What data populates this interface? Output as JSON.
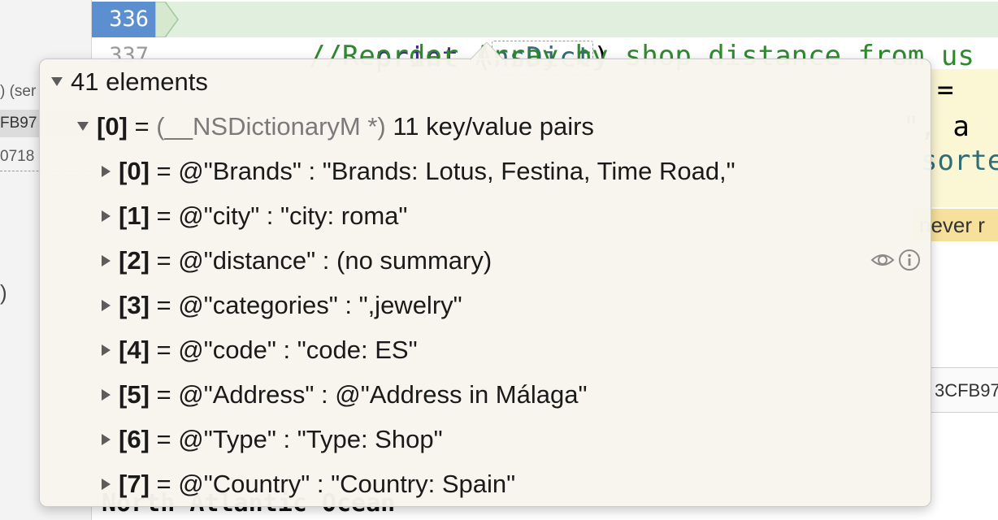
{
  "sidebar": {
    "rows": [
      ") (ser",
      "FB97",
      "0718"
    ]
  },
  "editor": {
    "lines": [
      {
        "number": "336",
        "keyword": "print",
        "open": " (",
        "variable": "nsDict",
        "close": ")"
      },
      {
        "number": "337",
        "comment": "//Reorder Array by shop distance from us"
      }
    ],
    "fragments": {
      "equals": "=",
      "string_quote": "\"",
      "string_tail": ", a",
      "sorted": "sorte",
      "warning": "never r",
      "side_box": "3CFB97",
      "bottom": "North Atlantic Ocean"
    }
  },
  "popover": {
    "root": {
      "label": "41 elements"
    },
    "item0": {
      "index": "[0]",
      "eq": " = ",
      "type": "(__NSDictionaryM *)",
      "summary": " 11 key/value pairs"
    },
    "children": [
      {
        "index": "[0]",
        "text": " = @\"Brands\" : \"Brands: Lotus, Festina, Time Road,\""
      },
      {
        "index": "[1]",
        "text": " = @\"city\" : \"city: roma\""
      },
      {
        "index": "[2]",
        "text": " = @\"distance\" : (no summary)"
      },
      {
        "index": "[3]",
        "text": " = @\"categories\" : \",jewelry\""
      },
      {
        "index": "[4]",
        "text": " = @\"code\" : \"code: ES\""
      },
      {
        "index": "[5]",
        "text": " = @\"Address\" : @\"Address in Málaga\""
      },
      {
        "index": "[6]",
        "text": " = @\"Type\" : \"Type: Shop\""
      },
      {
        "index": "[7]",
        "text": " = @\"Country\" : \"Country: Spain\""
      }
    ]
  }
}
